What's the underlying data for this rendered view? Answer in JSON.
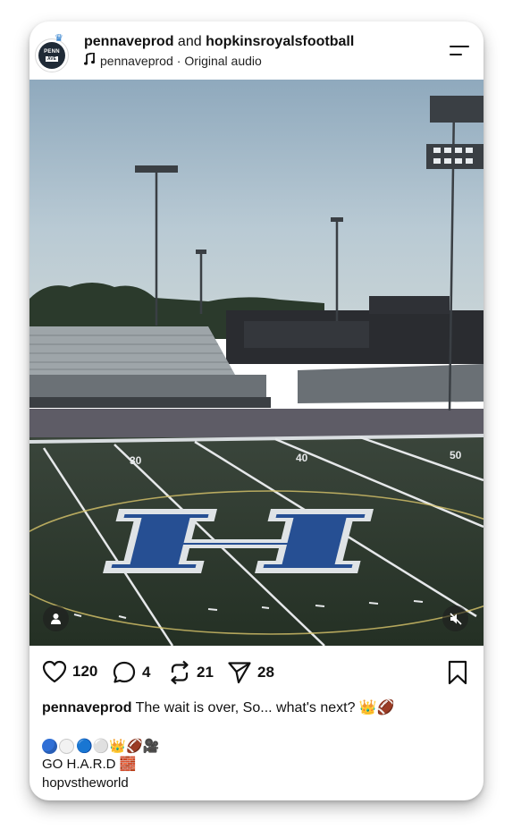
{
  "header": {
    "author_primary": "pennaveprod",
    "connector": "and",
    "author_secondary": "hopkinsroyalsfootball",
    "audio_author": "pennaveprod",
    "audio_separator": "·",
    "audio_label": "Original audio",
    "avatar_line1": "PENN",
    "avatar_line2": "AVE"
  },
  "media": {
    "field_numbers": [
      "30",
      "40",
      "50"
    ]
  },
  "actions": {
    "likes": "120",
    "comments": "4",
    "reposts": "21",
    "shares": "28"
  },
  "caption": {
    "username": "pennaveprod",
    "text": "The wait is over, So... what's next?",
    "emoji": "👑🏈"
  },
  "extra": {
    "line1_emoji": "🔵⚪👑🏈🎥",
    "line2_text": "GO H.A.R.D",
    "line2_emoji": "🧱",
    "line3_text": "hopvstheworld"
  },
  "colors": {
    "field_green": "#2e3b2f",
    "h_logo_blue": "#264f93",
    "sky": "#a9bfcf"
  }
}
